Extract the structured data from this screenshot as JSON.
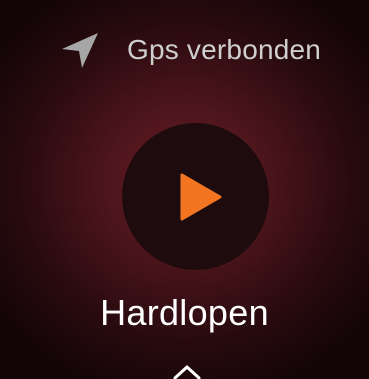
{
  "status": {
    "gps_icon": "navigation-arrow-icon",
    "gps_label": "Gps verbonden"
  },
  "start": {
    "icon": "play-icon",
    "accent_color": "#f47521"
  },
  "activity": {
    "title": "Hardlopen"
  },
  "footer": {
    "icon": "chevron-up-icon"
  },
  "colors": {
    "background_center": "#6b1d26",
    "background_edge": "#140507",
    "button_fill": "#1e0b0d",
    "status_text": "#cfcfcf",
    "title_text": "#ffffff"
  }
}
